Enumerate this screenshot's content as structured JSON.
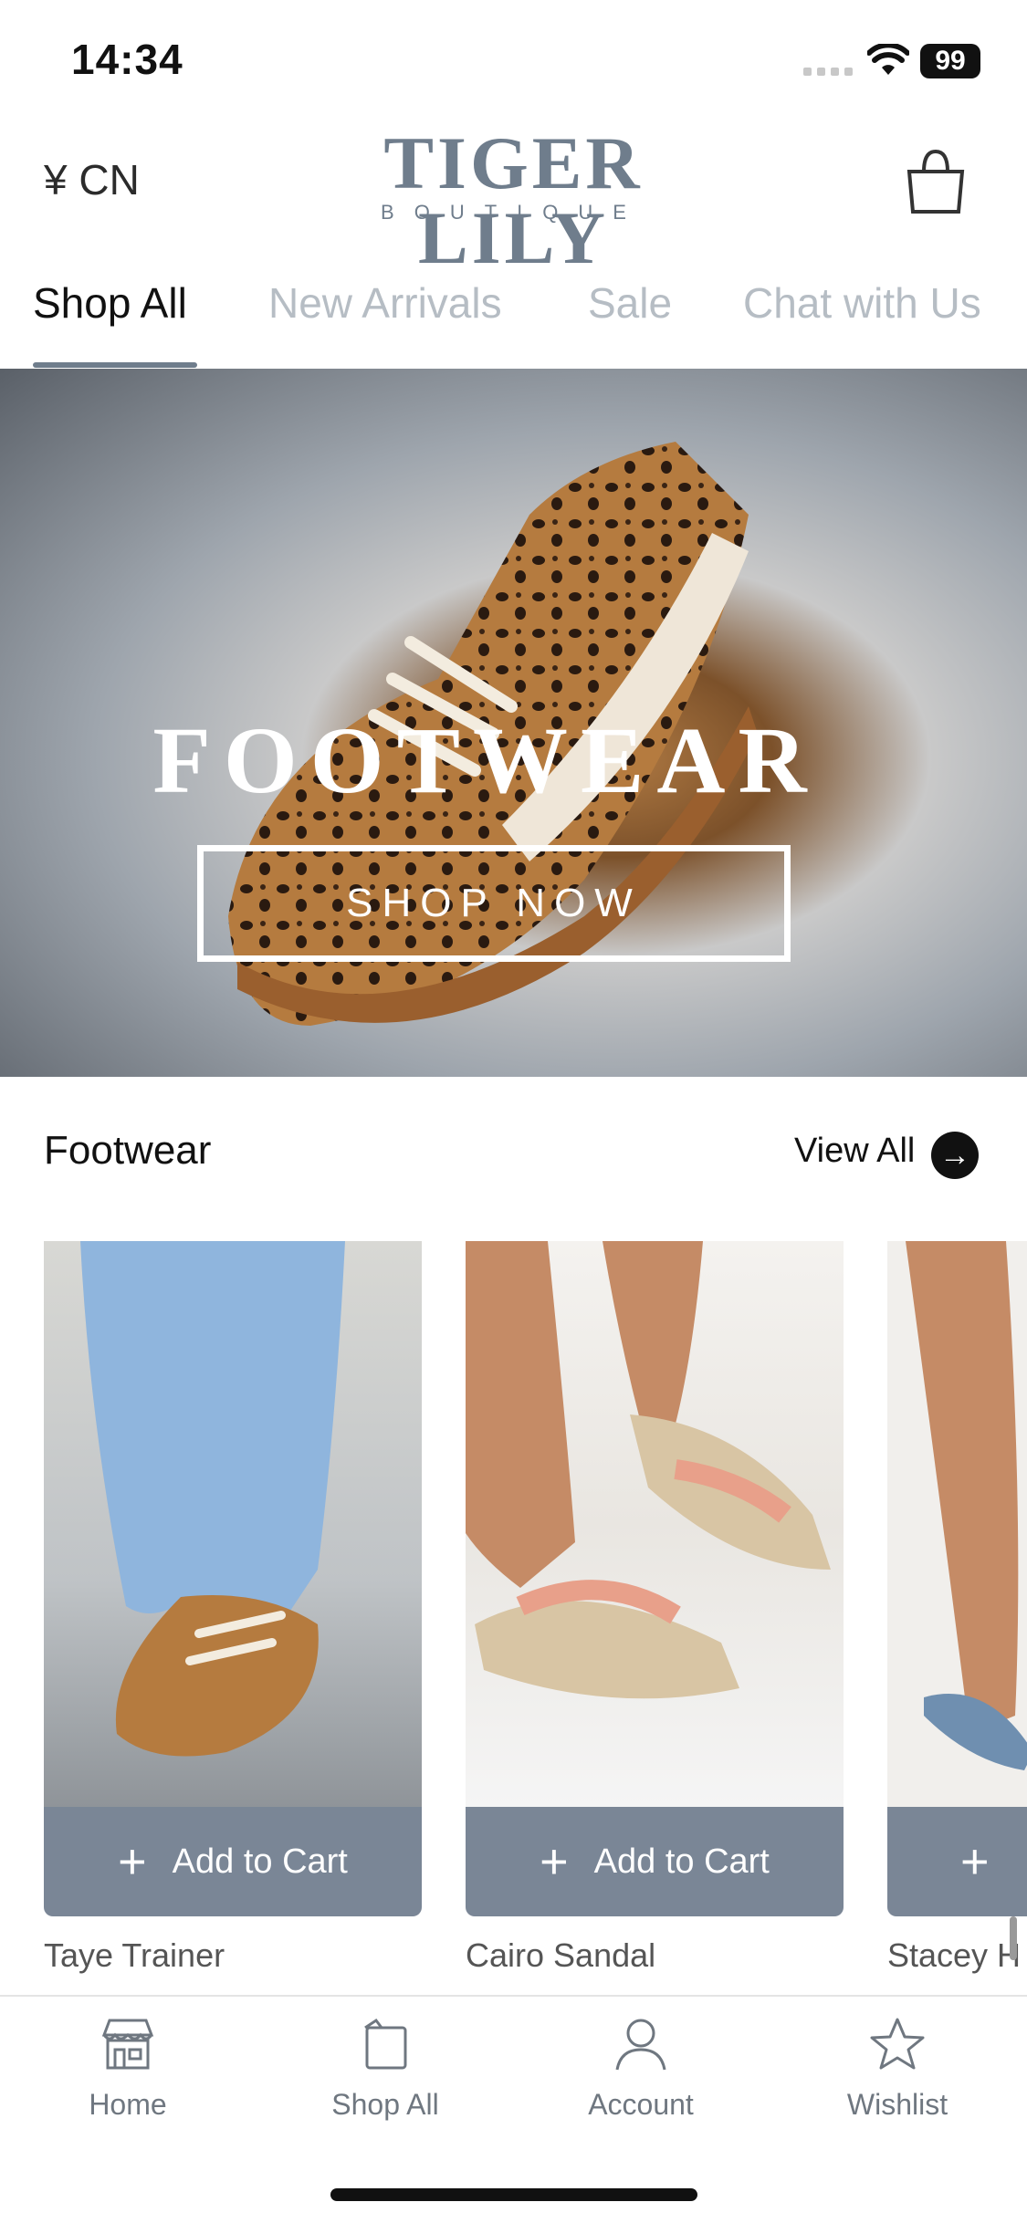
{
  "status_bar": {
    "time": "14:34",
    "battery": "99"
  },
  "header": {
    "currency": "¥ CN",
    "logo_main": "TIGER LILY",
    "logo_sub": "BOUTIQUE"
  },
  "tabs": [
    {
      "label": "Shop All",
      "active": true
    },
    {
      "label": "New Arrivals",
      "active": false
    },
    {
      "label": "Sale",
      "active": false
    },
    {
      "label": "Chat with Us",
      "active": false
    }
  ],
  "hero": {
    "title": "FOOTWEAR",
    "button": "SHOP NOW"
  },
  "section": {
    "title": "Footwear",
    "view_all": "View All"
  },
  "products": [
    {
      "name": "Taye Trainer",
      "button": "Add to Cart"
    },
    {
      "name": "Cairo Sandal",
      "button": "Add to Cart"
    },
    {
      "name": "Stacey H",
      "button": ""
    }
  ],
  "tabbar": [
    {
      "label": "Home",
      "icon": "store-icon"
    },
    {
      "label": "Shop All",
      "icon": "tag-icon"
    },
    {
      "label": "Account",
      "icon": "person-icon"
    },
    {
      "label": "Wishlist",
      "icon": "star-icon"
    }
  ],
  "colors": {
    "accent": "#7a8696",
    "logo": "#6f7d8c",
    "inactive_tab": "#b6bdc4"
  }
}
